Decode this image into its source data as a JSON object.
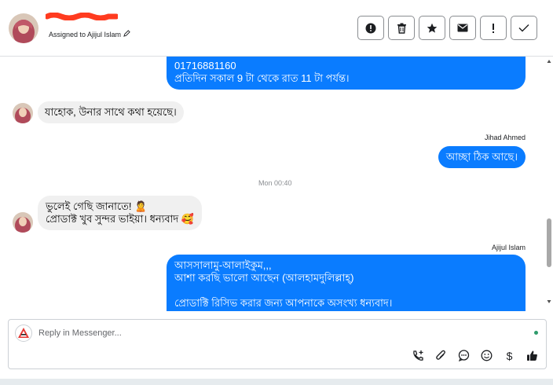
{
  "header": {
    "assigned_label": "Assigned to Ajijul Islam",
    "icons": [
      "alert-icon",
      "trash-icon",
      "star-icon",
      "mail-icon",
      "exclamation-icon",
      "check-icon"
    ],
    "actions": [
      {
        "name": "alert-button",
        "glyph": "!"
      },
      {
        "name": "delete-button",
        "glyph": "trash"
      },
      {
        "name": "star-button",
        "glyph": "★"
      },
      {
        "name": "mail-button",
        "glyph": "mail"
      },
      {
        "name": "important-button",
        "glyph": "!"
      },
      {
        "name": "done-button",
        "glyph": "✓"
      }
    ]
  },
  "messages": [
    {
      "dir": "out",
      "lines": [
        "01716881160",
        "প্রতিদিন সকাল 9 টা থেকে রাত 11 টা পর্যন্ত।"
      ]
    },
    {
      "dir": "in",
      "lines": [
        "যাহোক, উনার সাথে কথা হয়েছে।"
      ]
    },
    {
      "dir": "out",
      "sender": "Jihad Ahmed",
      "lines": [
        "আচ্ছা ঠিক আছে।"
      ]
    },
    {
      "dir": "timestamp",
      "text": "Mon 00:40"
    },
    {
      "dir": "in",
      "lines": [
        "ভুলেই গেছি জানাতে! 🙎",
        "প্রোডাক্ট খুব সুন্দর ভাইয়া। ধন্যবাদ 🥰"
      ]
    },
    {
      "dir": "out",
      "sender": "Ajijul Islam",
      "lines": [
        "আসসালামু-আলাইকুম,,,",
        "আশা করছি ভালো আছেন (আলহামদুলিল্লাহ্)",
        "",
        "প্রোডাক্টি রিসিভ করার জন্য আপনাকে অসংখ্য ধন্যবাদ।"
      ]
    }
  ],
  "composer": {
    "placeholder": "Reply in Messenger...",
    "tools": [
      "call-add-icon",
      "attach-icon",
      "chat-bubble-icon",
      "emoji-icon",
      "dollar-icon",
      "thumbs-up-icon"
    ],
    "dollar": "$"
  },
  "colors": {
    "outgoing_bubble": "#0a7cff",
    "incoming_bubble": "#f0f0f0",
    "redaction": "#ff3b1f",
    "online_dot": "#2e9b6b"
  }
}
